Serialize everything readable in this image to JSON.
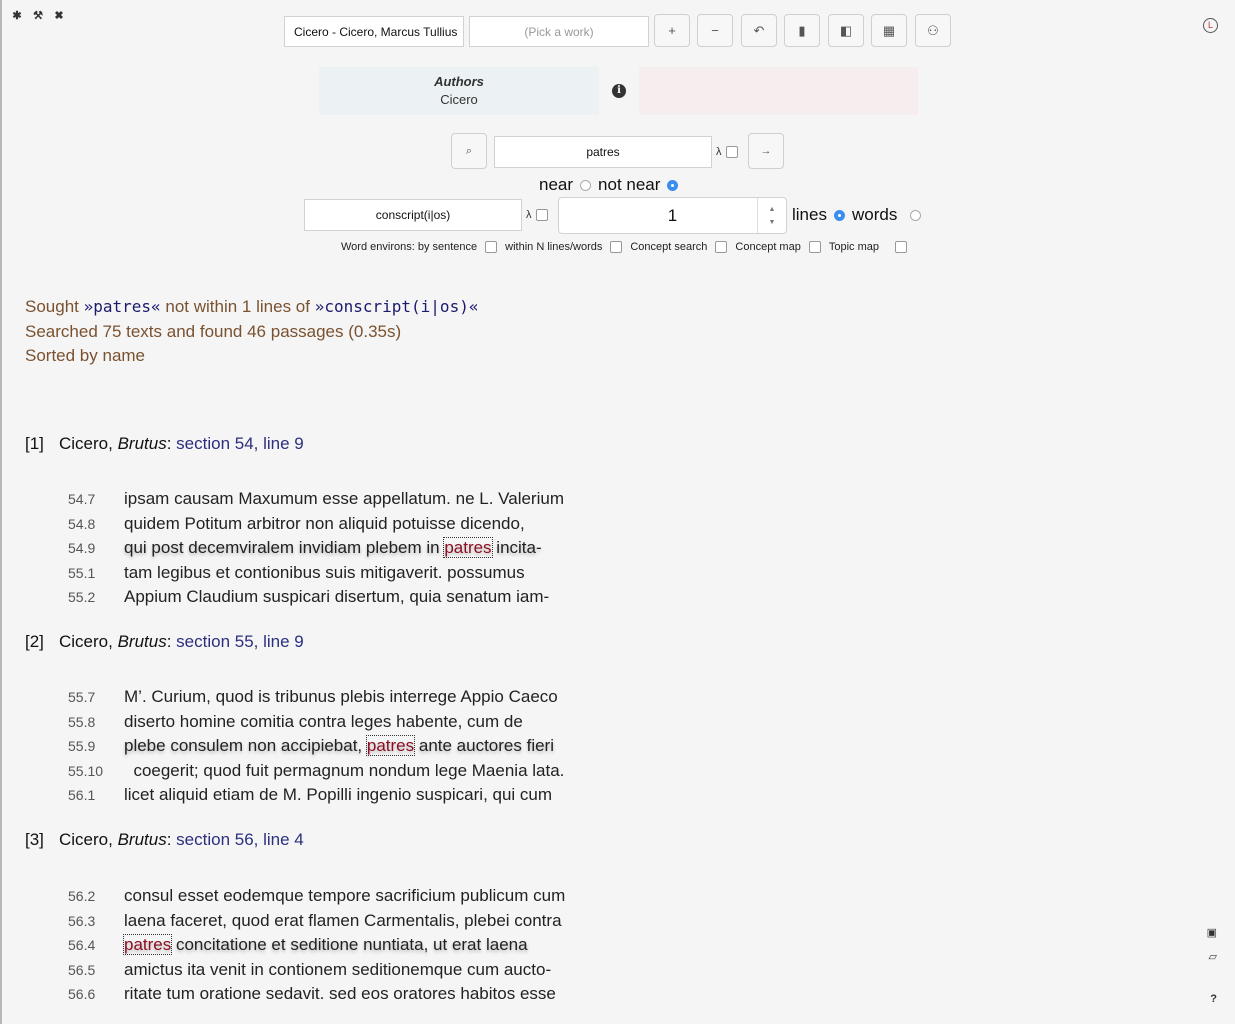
{
  "toolbar": {
    "top_icons": [
      {
        "name": "gear-icon",
        "glyph": "✱"
      },
      {
        "name": "wrench-icon",
        "glyph": "🔧"
      },
      {
        "name": "close-icon",
        "glyph": "✖"
      }
    ],
    "author_value": "Cicero - Cicero, Marcus Tullius",
    "work_placeholder": "(Pick a work)",
    "buttons": [
      {
        "name": "add-button",
        "glyph": "+"
      },
      {
        "name": "remove-button",
        "glyph": "−"
      },
      {
        "name": "undo-button",
        "glyph": "↶"
      },
      {
        "name": "book-button",
        "glyph": "▮"
      },
      {
        "name": "bookmark-button",
        "glyph": "◧"
      },
      {
        "name": "table-button",
        "glyph": "▦"
      },
      {
        "name": "user-button",
        "glyph": "⚇"
      }
    ],
    "clock_glyph": "L"
  },
  "selection": {
    "authors_title": "Authors",
    "authors_value": "Cicero",
    "info_glyph": "i"
  },
  "search": {
    "search_glyph": "⌕",
    "term": "patres",
    "lambda": "λ",
    "go_glyph": "→",
    "near_label": "near",
    "not_near_label": "not near",
    "proximity_term": "conscript(i|os)",
    "distance": "1",
    "lines_label": "lines",
    "words_label": "words",
    "options": [
      {
        "label": "Word environs:  by sentence"
      },
      {
        "label": "within N lines/words"
      },
      {
        "label": "Concept search"
      },
      {
        "label": "Concept map"
      },
      {
        "label": "Topic map"
      }
    ]
  },
  "summary": {
    "sought_prefix": "Sought ",
    "sought_term": "»patres«",
    "sought_mid": " not within 1 lines of ",
    "sought_prox": "»conscript(i|os)«",
    "searched": "Searched 75 texts and found 46 passages (0.35s)",
    "sorted": "Sorted by name"
  },
  "passages": [
    {
      "index": "[1]",
      "author": "Cicero, ",
      "work": "Brutus",
      "sep": ": ",
      "ref": "section 54, line 9",
      "lines": [
        {
          "num": "54.7",
          "pre": "ipsam causam Maxumum esse appellatum. ne L. Valerium",
          "hit": "",
          "post": ""
        },
        {
          "num": "54.8",
          "pre": "quidem Potitum arbitror non aliquid potuisse dicendo,",
          "hit": "",
          "post": ""
        },
        {
          "num": "54.9",
          "pre": "qui post decemviralem invidiam plebem in ",
          "hit": "patres",
          "post": " incita-"
        },
        {
          "num": "55.1",
          "pre": "tam legibus et contionibus suis mitigaverit. possumus",
          "hit": "",
          "post": ""
        },
        {
          "num": "55.2",
          "pre": "Appium Claudium suspicari disertum, quia senatum iam-",
          "hit": "",
          "post": ""
        }
      ]
    },
    {
      "index": "[2]",
      "author": "Cicero, ",
      "work": "Brutus",
      "sep": ": ",
      "ref": "section 55, line 9",
      "lines": [
        {
          "num": "55.7",
          "pre": "M’. Curium, quod is tribunus plebis interrege Appio Caeco",
          "hit": "",
          "post": ""
        },
        {
          "num": "55.8",
          "pre": "diserto homine comitia contra leges habente, cum de",
          "hit": "",
          "post": ""
        },
        {
          "num": "55.9",
          "pre": "plebe consulem non accipiebat, ",
          "hit": "patres",
          "post": " ante auctores fieri"
        },
        {
          "num": "55.10",
          "pre": "  coegerit; quod fuit permagnum nondum lege Maenia lata.",
          "hit": "",
          "post": ""
        },
        {
          "num": "56.1",
          "pre": "licet aliquid etiam de M. Popilli ingenio suspicari, qui cum",
          "hit": "",
          "post": ""
        }
      ]
    },
    {
      "index": "[3]",
      "author": "Cicero, ",
      "work": "Brutus",
      "sep": ": ",
      "ref": "section 56, line 4",
      "lines": [
        {
          "num": "56.2",
          "pre": "consul esset eodemque tempore sacrificium publicum cum",
          "hit": "",
          "post": ""
        },
        {
          "num": "56.3",
          "pre": "laena faceret, quod erat flamen Carmentalis, plebei contra",
          "hit": "",
          "post": ""
        },
        {
          "num": "56.4",
          "pre": "",
          "hit": "patres",
          "post": " concitatione et seditione nuntiata, ut erat laena"
        },
        {
          "num": "56.5",
          "pre": "amictus ita venit in contionem seditionemque cum aucto-",
          "hit": "",
          "post": ""
        },
        {
          "num": "56.6",
          "pre": "ritate tum oratione sedavit. sed eos oratores habitos esse",
          "hit": "",
          "post": ""
        }
      ]
    }
  ],
  "side": {
    "save_glyph": "▣",
    "open_glyph": "📂",
    "help_glyph": "?"
  }
}
